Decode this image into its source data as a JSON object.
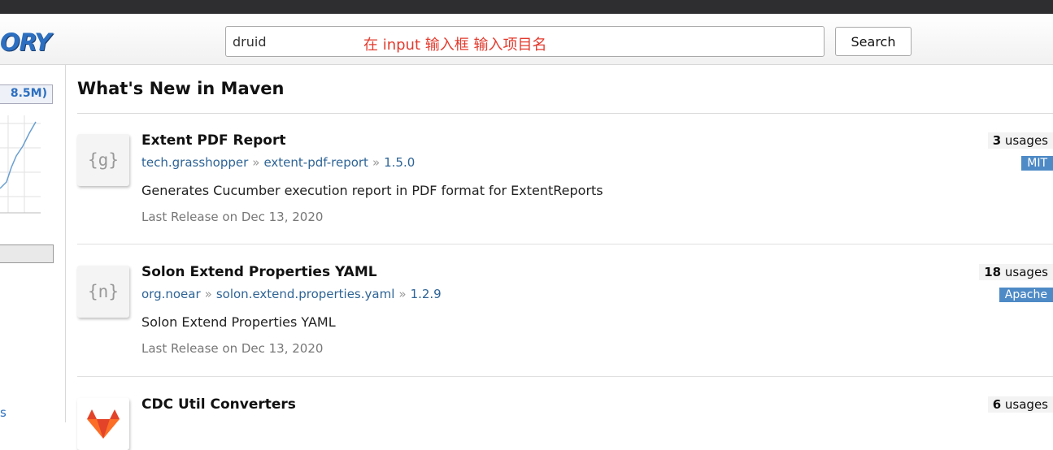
{
  "header": {
    "logo": "ORY",
    "search_value": "druid",
    "search_annotation": "在 input 输入框 输入项目名",
    "search_button": "Search"
  },
  "sidebar": {
    "count_label": "8.5M)",
    "link_fragment": "s"
  },
  "main": {
    "title": "What's New in Maven",
    "items": [
      {
        "icon_letter": "{g}",
        "name": "Extent PDF Report",
        "group": "tech.grasshopper",
        "artifact": "extent-pdf-report",
        "version": "1.5.0",
        "description": "Generates Cucumber execution report in PDF format for ExtentReports",
        "release": "Last Release on Dec 13, 2020",
        "usages_count": "3",
        "usages_label": "usages",
        "license": "MIT"
      },
      {
        "icon_letter": "{n}",
        "name": "Solon Extend Properties YAML",
        "group": "org.noear",
        "artifact": "solon.extend.properties.yaml",
        "version": "1.2.9",
        "description": "Solon Extend Properties YAML",
        "release": "Last Release on Dec 13, 2020",
        "usages_count": "18",
        "usages_label": "usages",
        "license": "Apache"
      },
      {
        "icon_letter": "",
        "name": "CDC Util Converters",
        "usages_count": "6",
        "usages_label": "usages"
      }
    ],
    "separator": "»"
  },
  "colors": {
    "link": "#2e6496",
    "license_badge": "#4e8ac6",
    "annotation": "#e23b2e",
    "logo": "#2c6fc1"
  }
}
